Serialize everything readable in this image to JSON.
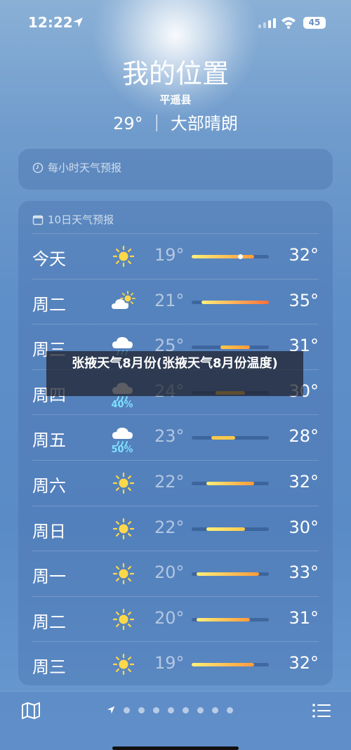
{
  "status": {
    "time": "12:22",
    "battery": "45"
  },
  "header": {
    "title": "我的位置",
    "location": "平遥县",
    "current": "29° ｜ 大部晴朗"
  },
  "hourly": {
    "label": "每小时天气预报"
  },
  "forecast": {
    "label": "10日天气预报",
    "scale": {
      "min": 19,
      "max": 35
    },
    "days": [
      {
        "day": "今天",
        "icon": "sun-icon",
        "lo": "19°",
        "hi": "32°",
        "lo_val": 19,
        "hi_val": 32,
        "pct": "",
        "current": 29
      },
      {
        "day": "周二",
        "icon": "partly-cloudy-icon",
        "lo": "21°",
        "hi": "35°",
        "lo_val": 21,
        "hi_val": 35,
        "pct": ""
      },
      {
        "day": "周三",
        "icon": "rain-icon",
        "lo": "25°",
        "hi": "31°",
        "lo_val": 25,
        "hi_val": 31,
        "pct": ""
      },
      {
        "day": "周四",
        "icon": "rain-icon",
        "lo": "24°",
        "hi": "30°",
        "lo_val": 24,
        "hi_val": 30,
        "pct": "40%"
      },
      {
        "day": "周五",
        "icon": "rain-icon",
        "lo": "23°",
        "hi": "28°",
        "lo_val": 23,
        "hi_val": 28,
        "pct": "50%"
      },
      {
        "day": "周六",
        "icon": "sun-icon",
        "lo": "22°",
        "hi": "32°",
        "lo_val": 22,
        "hi_val": 32,
        "pct": ""
      },
      {
        "day": "周日",
        "icon": "sun-icon",
        "lo": "22°",
        "hi": "30°",
        "lo_val": 22,
        "hi_val": 30,
        "pct": ""
      },
      {
        "day": "周一",
        "icon": "sun-icon",
        "lo": "20°",
        "hi": "33°",
        "lo_val": 20,
        "hi_val": 33,
        "pct": ""
      },
      {
        "day": "周二",
        "icon": "sun-icon",
        "lo": "20°",
        "hi": "31°",
        "lo_val": 20,
        "hi_val": 31,
        "pct": ""
      },
      {
        "day": "周三",
        "icon": "sun-icon",
        "lo": "19°",
        "hi": "32°",
        "lo_val": 19,
        "hi_val": 32,
        "pct": ""
      }
    ]
  },
  "overlay": {
    "text": "张掖天气8月份(张掖天气8月份温度)"
  },
  "colors": {
    "sun": "#ffd84a",
    "bar_cool": "#ffd34a",
    "bar_warm": "#ff8a3a"
  }
}
